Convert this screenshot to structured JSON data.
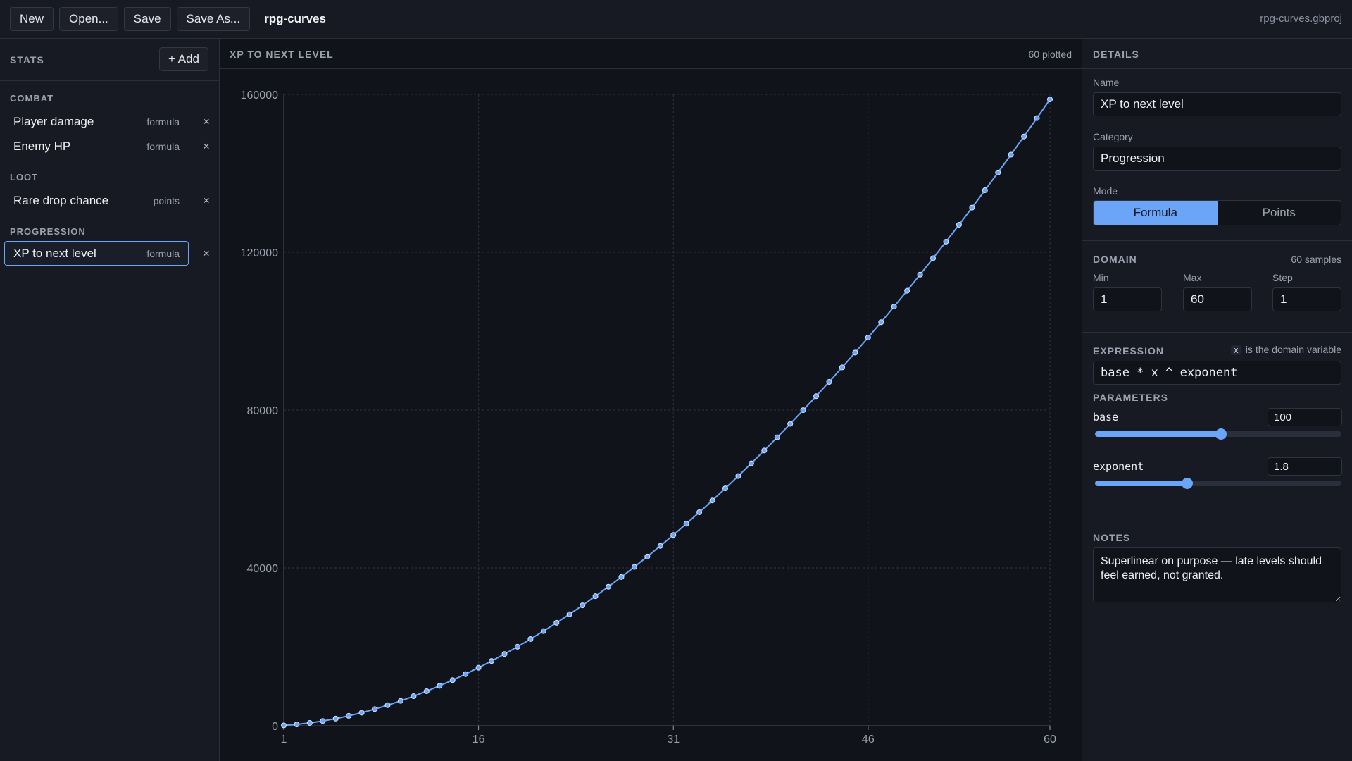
{
  "toolbar": {
    "new_label": "New",
    "open_label": "Open...",
    "save_label": "Save",
    "save_as_label": "Save As...",
    "app_title": "rpg-curves",
    "file_name": "rpg-curves.gbproj"
  },
  "sidebar": {
    "title": "STATS",
    "add_label": "+ Add",
    "remove_glyph": "×",
    "groups": [
      {
        "title": "COMBAT",
        "items": [
          {
            "name": "Player damage",
            "mode": "formula"
          },
          {
            "name": "Enemy HP",
            "mode": "formula"
          }
        ]
      },
      {
        "title": "LOOT",
        "items": [
          {
            "name": "Rare drop chance",
            "mode": "points"
          }
        ]
      },
      {
        "title": "PROGRESSION",
        "items": [
          {
            "name": "XP to next level",
            "mode": "formula",
            "selected": true
          }
        ]
      }
    ]
  },
  "chart": {
    "title": "XP TO NEXT LEVEL",
    "plotted_label": "60 plotted"
  },
  "details": {
    "title": "DETAILS",
    "name_label": "Name",
    "name_value": "XP to next level",
    "category_label": "Category",
    "category_value": "Progression",
    "mode_label": "Mode",
    "mode_formula": "Formula",
    "mode_points": "Points",
    "domain": {
      "title": "DOMAIN",
      "samples_label": "60 samples",
      "min_label": "Min",
      "min_value": "1",
      "max_label": "Max",
      "max_value": "60",
      "step_label": "Step",
      "step_value": "1"
    },
    "expression": {
      "title": "EXPRESSION",
      "hint_var": "x",
      "hint_text": "is the domain variable",
      "value": "base * x ^ exponent"
    },
    "parameters": {
      "title": "PARAMETERS",
      "items": [
        {
          "name": "base",
          "value": "100",
          "fraction": 0.51
        },
        {
          "name": "exponent",
          "value": "1.8",
          "fraction": 0.375
        }
      ]
    },
    "notes": {
      "title": "NOTES",
      "value": "Superlinear on purpose — late levels should feel earned, not granted."
    }
  },
  "colors": {
    "accent": "#6aa5f8",
    "background": "#11131a",
    "panel": "#171a22",
    "grid": "#2f3340"
  },
  "chart_data": {
    "type": "line",
    "title": "XP TO NEXT LEVEL",
    "xlabel": "",
    "ylabel": "",
    "formula": "100 * x ^ 1.8",
    "x_range": [
      1,
      60
    ],
    "step": 1,
    "xlim": [
      1,
      60
    ],
    "ylim": [
      0,
      160000
    ],
    "x_ticks": [
      1,
      16,
      31,
      46,
      60
    ],
    "y_ticks": [
      0,
      40000,
      80000,
      120000,
      160000
    ],
    "grid": true,
    "markers": true
  }
}
